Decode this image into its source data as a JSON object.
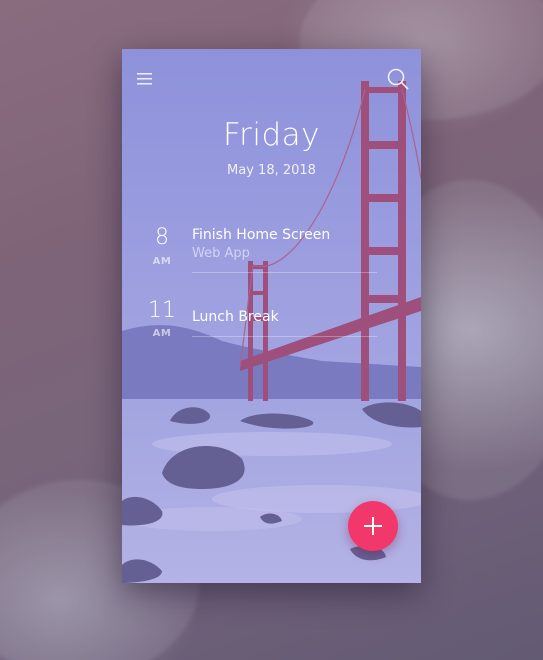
{
  "header": {
    "menu_icon": "hamburger-menu-icon",
    "search_icon": "search-icon"
  },
  "day": {
    "title": "Friday",
    "date": "May 18, 2018"
  },
  "events": [
    {
      "hour": "8",
      "ampm": "AM",
      "title": "Finish Home Screen",
      "subtitle": "Web App"
    },
    {
      "hour": "11",
      "ampm": "AM",
      "title": "Lunch Break",
      "subtitle": ""
    }
  ],
  "fab": {
    "icon": "plus-icon",
    "color": "#f2386b"
  },
  "colors": {
    "card_tint": "#7878d7",
    "bridge": "#b23a4a",
    "accent": "#f2386b"
  }
}
